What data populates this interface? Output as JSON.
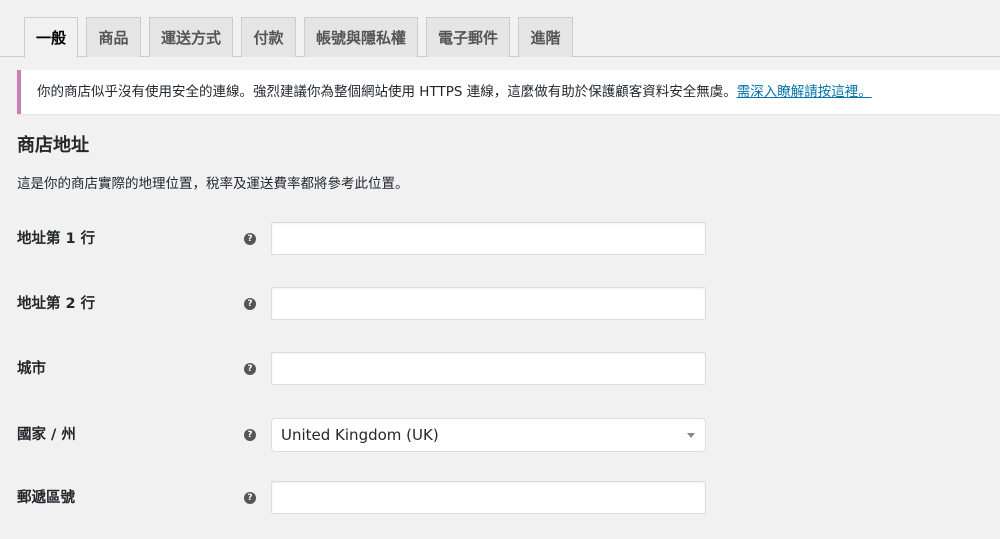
{
  "tabs": [
    {
      "label": "一般",
      "active": true
    },
    {
      "label": "商品"
    },
    {
      "label": "運送方式"
    },
    {
      "label": "付款"
    },
    {
      "label": "帳號與隱私權"
    },
    {
      "label": "電子郵件"
    },
    {
      "label": "進階"
    }
  ],
  "notice": {
    "text": "你的商店似乎沒有使用安全的連線。強烈建議你為整個網站使用 HTTPS 連線，這麼做有助於保護顧客資料安全無虞。",
    "link": "需深入瞭解請按這裡。"
  },
  "section": {
    "title": "商店地址",
    "description": "這是你的商店實際的地理位置，稅率及運送費率都將參考此位置。"
  },
  "fields": {
    "address1": {
      "label": "地址第 1 行",
      "value": ""
    },
    "address2": {
      "label": "地址第 2 行",
      "value": ""
    },
    "city": {
      "label": "城市",
      "value": ""
    },
    "country": {
      "label": "國家 / 州",
      "value": "United Kingdom (UK)"
    },
    "postcode": {
      "label": "郵遞區號",
      "value": ""
    }
  },
  "icons": {
    "help": "?"
  },
  "colors": {
    "notice_border": "#c97fb6",
    "link": "#0073aa"
  }
}
